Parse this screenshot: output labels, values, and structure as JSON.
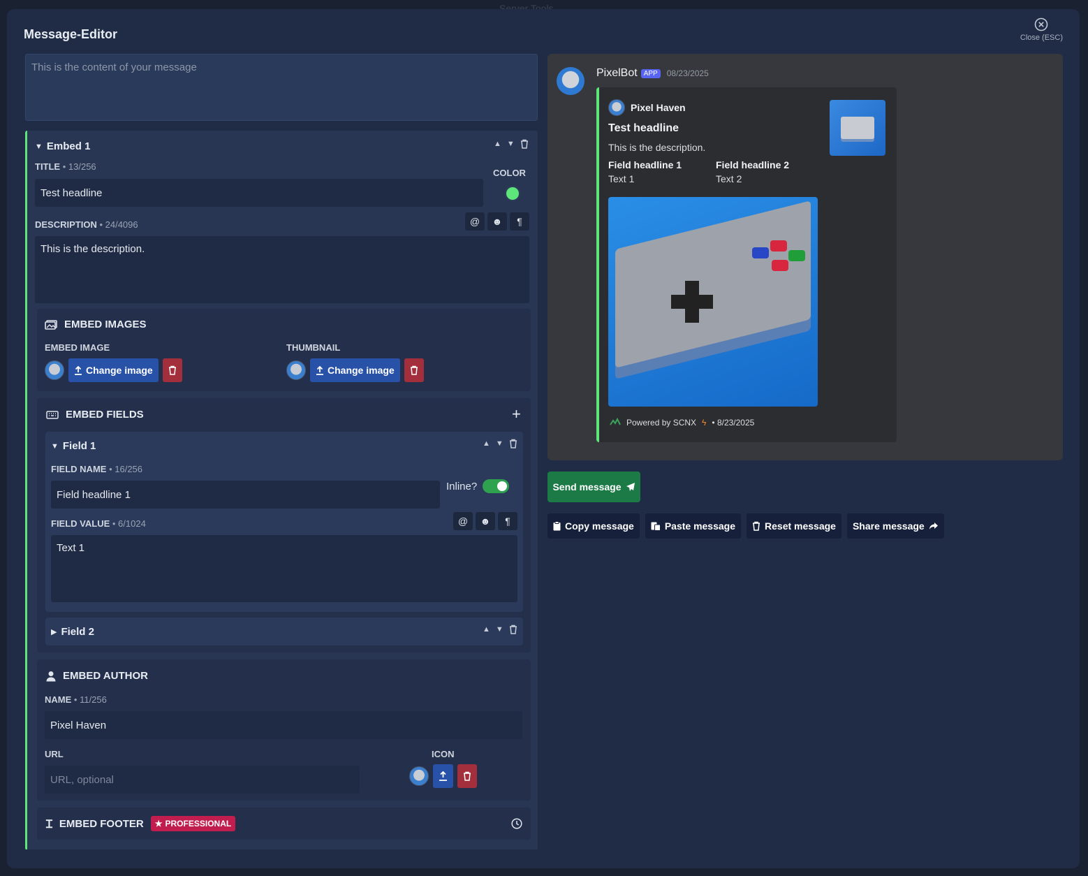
{
  "backdrop": {
    "ghost_text": "Server Tools"
  },
  "modal": {
    "title": "Message-Editor",
    "close_label": "Close (ESC)"
  },
  "editor": {
    "content_placeholder": "This is the content of your message",
    "embed": {
      "title": "Embed 1",
      "title_label": "TITLE",
      "title_count": "• 13/256",
      "title_value": "Test headline",
      "color_label": "COLOR",
      "color_value": "#5de67a",
      "description_label": "DESCRIPTION",
      "description_count": "• 24/4096",
      "description_value": "This is the description.",
      "images": {
        "heading": "EMBED IMAGES",
        "embed_image_label": "EMBED IMAGE",
        "thumbnail_label": "THUMBNAIL",
        "change_label": "Change image"
      },
      "fields": {
        "heading": "EMBED FIELDS",
        "field1": {
          "title": "Field 1",
          "name_label": "FIELD NAME",
          "name_count": "• 16/256",
          "name_value": "Field headline 1",
          "inline_label": "Inline?",
          "value_label": "FIELD VALUE",
          "value_count": "• 6/1024",
          "value_value": "Text 1"
        },
        "field2": {
          "title": "Field 2"
        }
      },
      "author": {
        "heading": "EMBED AUTHOR",
        "name_label": "NAME",
        "name_count": "• 11/256",
        "name_value": "Pixel Haven",
        "url_label": "URL",
        "url_placeholder": "URL, optional",
        "icon_label": "ICON"
      },
      "footer": {
        "heading": "EMBED FOOTER",
        "badge": "PROFESSIONAL"
      }
    }
  },
  "preview": {
    "bot_name": "PixelBot",
    "app_tag": "APP",
    "date": "08/23/2025",
    "author_name": "Pixel Haven",
    "title": "Test headline",
    "description": "This is the description.",
    "fields": [
      {
        "name": "Field headline 1",
        "value": "Text 1"
      },
      {
        "name": "Field headline 2",
        "value": "Text 2"
      }
    ],
    "footer_text": "Powered by SCNX",
    "footer_date": "• 8/23/2025"
  },
  "actions": {
    "send": "Send message",
    "copy": "Copy message",
    "paste": "Paste message",
    "reset": "Reset message",
    "share": "Share message"
  },
  "colors": {
    "accent": "#5de67a",
    "send": "#1b7a45",
    "primary": "#2851a8",
    "danger": "#a32f3c",
    "badge": "#c21d4f",
    "discord_app": "#5865f2"
  }
}
